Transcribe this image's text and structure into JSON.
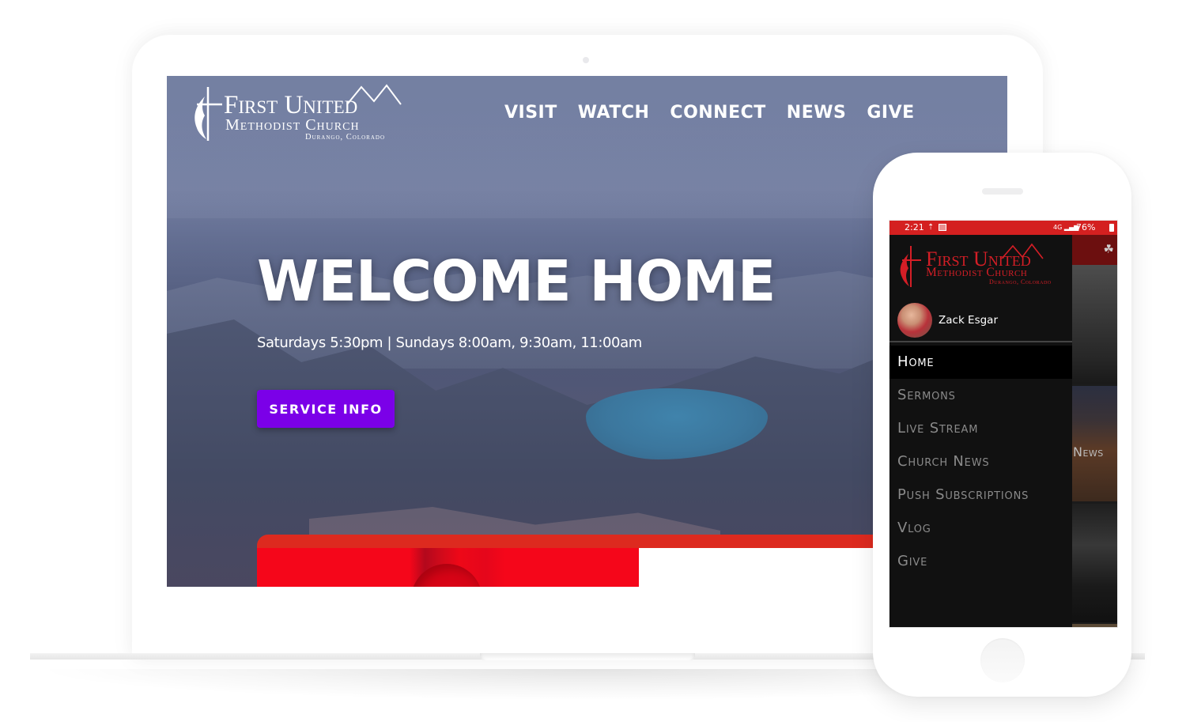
{
  "website": {
    "logo": {
      "line1": "First United",
      "line2": "Methodist Church",
      "line3": "Durango, Colorado"
    },
    "nav": [
      {
        "label": "VISIT"
      },
      {
        "label": "WATCH"
      },
      {
        "label": "CONNECT"
      },
      {
        "label": "NEWS"
      },
      {
        "label": "GIVE"
      }
    ],
    "hero": {
      "title": "WELCOME HOME",
      "subtitle": "Saturdays 5:30pm | Sundays 8:00am, 9:30am, 11:00am",
      "button_label": "SERVICE INFO"
    },
    "colors": {
      "button": "#7b00e8",
      "accent_red": "#dd2a1f"
    }
  },
  "phone": {
    "status_bar": {
      "time": "2:21",
      "upload_icon": "upload-icon",
      "image_icon": "image-icon",
      "signal": "4G",
      "battery": "76%",
      "color": "#d42020"
    },
    "drawer": {
      "logo": {
        "line1": "First United",
        "line2": "Methodist Church",
        "line3": "Durango, Colorado"
      },
      "user": {
        "name": "Zack Esgar"
      },
      "menu": [
        {
          "label": "Home",
          "active": true
        },
        {
          "label": "Sermons",
          "active": false
        },
        {
          "label": "Live Stream",
          "active": false
        },
        {
          "label": "Church News",
          "active": false
        },
        {
          "label": "Push Subscriptions",
          "active": false
        },
        {
          "label": "Vlog",
          "active": false
        },
        {
          "label": "Give",
          "active": false
        }
      ]
    },
    "background_content": {
      "give_icon": "hand-plant-icon",
      "card_label": "News"
    }
  }
}
